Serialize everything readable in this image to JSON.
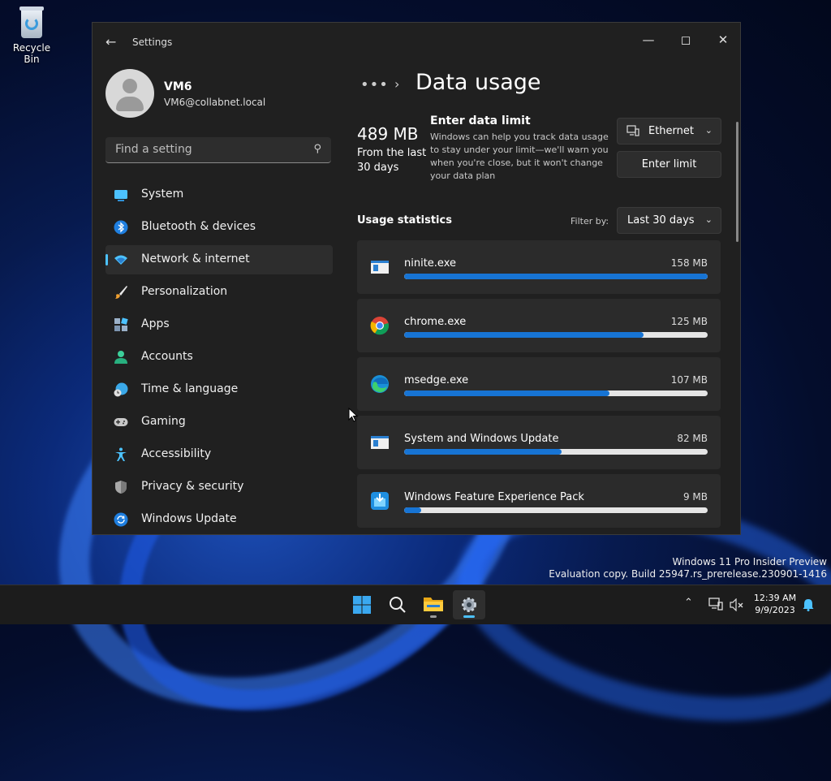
{
  "desktop": {
    "recycle_bin_label": "Recycle Bin"
  },
  "window": {
    "title": "Settings",
    "back_icon": "back-arrow-icon",
    "controls": [
      "minimize-icon",
      "maximize-icon",
      "close-icon"
    ]
  },
  "user": {
    "name": "VM6",
    "email": "VM6@collabnet.local"
  },
  "search": {
    "placeholder": "Find a setting"
  },
  "nav": {
    "items": [
      {
        "label": "System",
        "icon": "system-icon",
        "active": false
      },
      {
        "label": "Bluetooth & devices",
        "icon": "bluetooth-icon",
        "active": false
      },
      {
        "label": "Network & internet",
        "icon": "wifi-icon",
        "active": true
      },
      {
        "label": "Personalization",
        "icon": "brush-icon",
        "active": false
      },
      {
        "label": "Apps",
        "icon": "apps-icon",
        "active": false
      },
      {
        "label": "Accounts",
        "icon": "accounts-icon",
        "active": false
      },
      {
        "label": "Time & language",
        "icon": "globe-clock-icon",
        "active": false
      },
      {
        "label": "Gaming",
        "icon": "gamepad-icon",
        "active": false
      },
      {
        "label": "Accessibility",
        "icon": "accessibility-icon",
        "active": false
      },
      {
        "label": "Privacy & security",
        "icon": "shield-icon",
        "active": false
      },
      {
        "label": "Windows Update",
        "icon": "update-icon",
        "active": false
      }
    ]
  },
  "breadcrumb": {
    "more": "•••",
    "separator": "›",
    "title": "Data usage"
  },
  "summary": {
    "total": "489 MB",
    "period": "From the last 30 days"
  },
  "limit": {
    "heading": "Enter data limit",
    "description": "Windows can help you track data usage to stay under your limit—we'll warn you when you're close, but it won't change your data plan",
    "adapter": "Ethernet",
    "button": "Enter limit"
  },
  "usage": {
    "heading": "Usage statistics",
    "filter_label": "Filter by:",
    "filter_value": "Last 30 days",
    "apps": [
      {
        "name": "ninite.exe",
        "size": "158 MB",
        "fraction": 1.0,
        "icon": "app-window-icon"
      },
      {
        "name": "chrome.exe",
        "size": "125 MB",
        "fraction": 0.79,
        "icon": "chrome-icon"
      },
      {
        "name": "msedge.exe",
        "size": "107 MB",
        "fraction": 0.677,
        "icon": "edge-icon"
      },
      {
        "name": "System and Windows Update",
        "size": "82 MB",
        "fraction": 0.519,
        "icon": "app-window-icon"
      },
      {
        "name": "Windows Feature Experience Pack",
        "size": "9 MB",
        "fraction": 0.057,
        "icon": "feature-pack-icon"
      }
    ]
  },
  "watermark": {
    "line1": "Windows 11 Pro Insider Preview",
    "line2": "Evaluation copy. Build 25947.rs_prerelease.230901-1416"
  },
  "taskbar": {
    "time": "12:39 AM",
    "date": "9/9/2023"
  },
  "colors": {
    "accent": "#4cc2ff",
    "bar_fill": "#1774d4",
    "bar_track": "#e5e5e5",
    "window_bg": "#202020",
    "card_bg": "#2b2b2b"
  }
}
